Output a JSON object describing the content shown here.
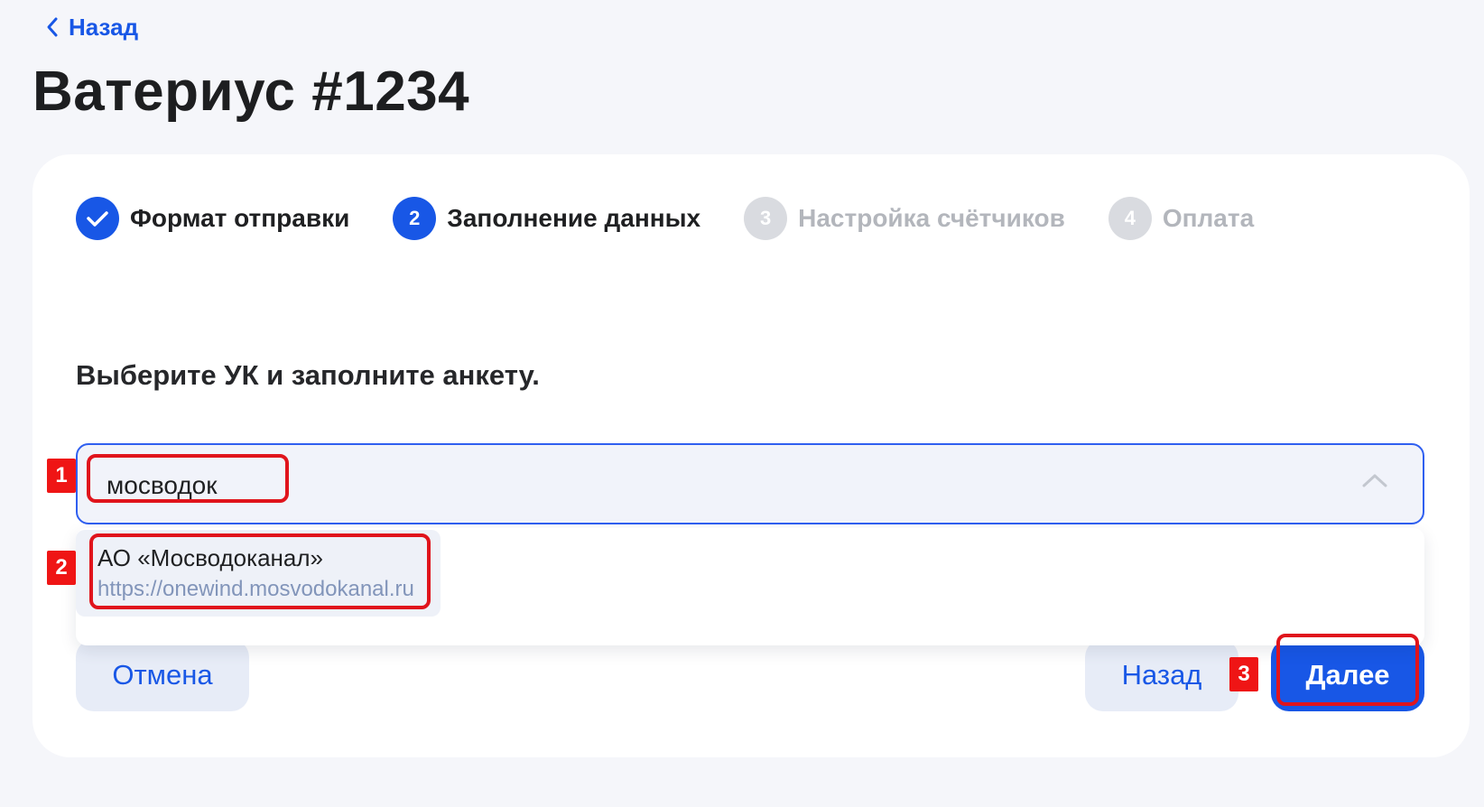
{
  "nav": {
    "back_label": "Назад"
  },
  "page": {
    "title": "Ватериус #1234"
  },
  "steps": [
    {
      "number": "",
      "label": "Формат отправки",
      "state": "done"
    },
    {
      "number": "2",
      "label": "Заполнение данных",
      "state": "current"
    },
    {
      "number": "3",
      "label": "Настройка счётчиков",
      "state": "inactive"
    },
    {
      "number": "4",
      "label": "Оплата",
      "state": "inactive"
    }
  ],
  "form": {
    "instruction": "Выберите УК и заполните анкету.",
    "search_value": "мосводок"
  },
  "dropdown": {
    "options": [
      {
        "name": "АО «Мосводоканал»",
        "url": "https://onewind.mosvodokanal.ru"
      }
    ]
  },
  "actions": {
    "cancel_label": "Отмена",
    "back_label": "Назад",
    "next_label": "Далее"
  },
  "annotations": {
    "markers": [
      "1",
      "2",
      "3"
    ]
  },
  "colors": {
    "accent": "#1857e6",
    "inactive_step": "#d9dbe0",
    "highlight": "#e0141c"
  }
}
